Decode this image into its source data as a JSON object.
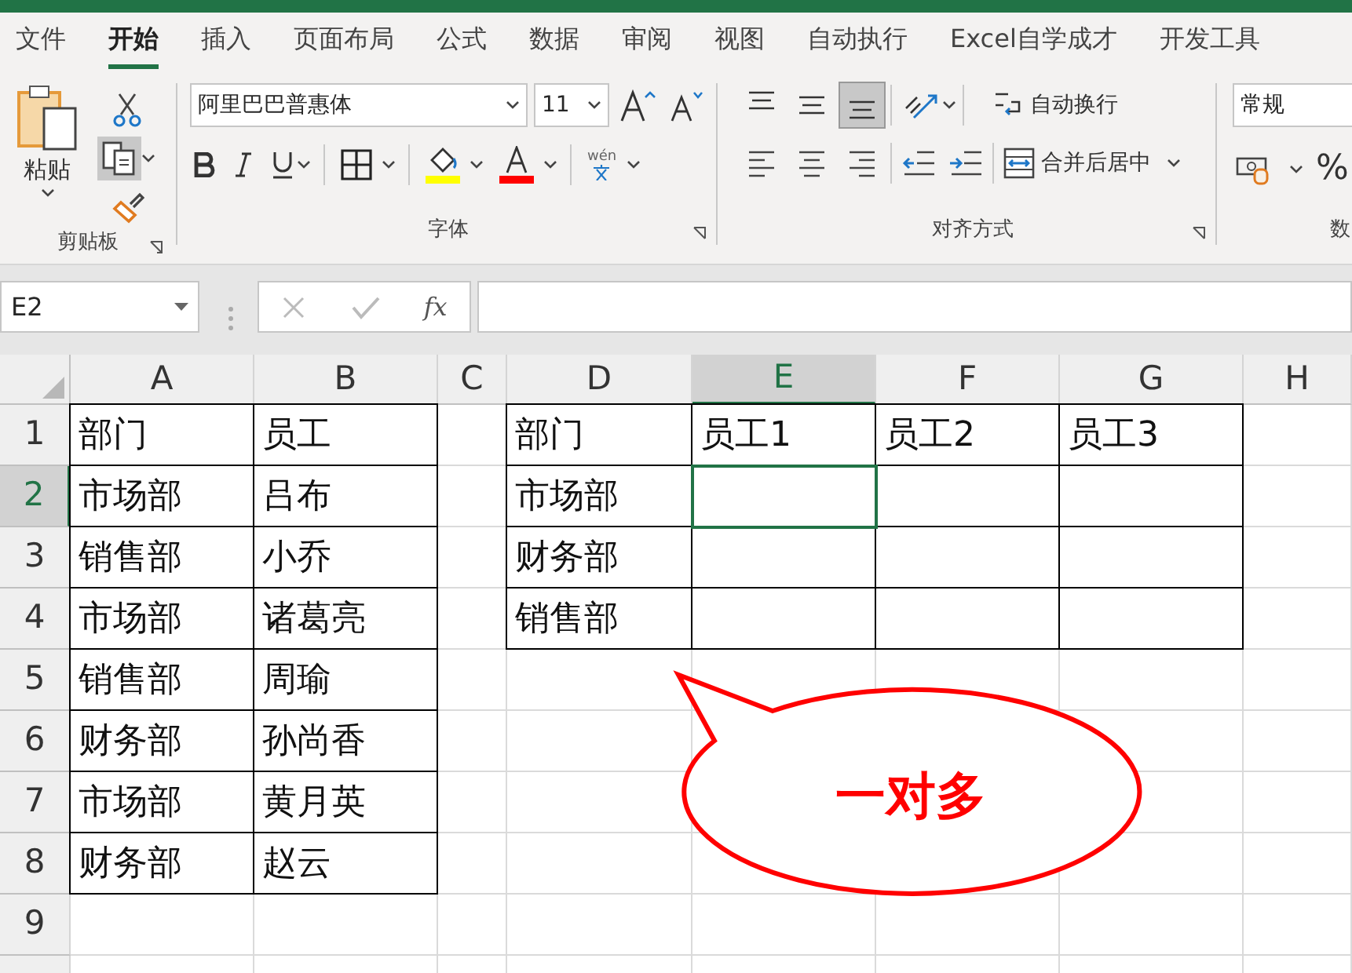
{
  "tabs": [
    {
      "label": "文件",
      "selected": false
    },
    {
      "label": "开始",
      "selected": true
    },
    {
      "label": "插入",
      "selected": false
    },
    {
      "label": "页面布局",
      "selected": false
    },
    {
      "label": "公式",
      "selected": false
    },
    {
      "label": "数据",
      "selected": false
    },
    {
      "label": "审阅",
      "selected": false
    },
    {
      "label": "视图",
      "selected": false
    },
    {
      "label": "自动执行",
      "selected": false
    },
    {
      "label": "Excel自学成才",
      "selected": false
    },
    {
      "label": "开发工具",
      "selected": false
    }
  ],
  "ribbon": {
    "clipboard": {
      "paste_label": "粘贴",
      "group_label": "剪贴板"
    },
    "font": {
      "font_name": "阿里巴巴普惠体",
      "font_size": "11",
      "phonetic_label": "wén",
      "group_label": "字体"
    },
    "alignment": {
      "vertical_buttons": [
        {
          "kind": "top",
          "selected": false
        },
        {
          "kind": "middle",
          "selected": false
        },
        {
          "kind": "bottom",
          "selected": true
        }
      ],
      "wrap_text": "自动换行",
      "merge_center": "合并后居中",
      "group_label": "对齐方式"
    },
    "number": {
      "format": "常规",
      "percent": "%",
      "group_label": "数"
    }
  },
  "formula_bar": {
    "name_box": "E2",
    "fx": "fx"
  },
  "columns": [
    {
      "label": "A",
      "selected": false
    },
    {
      "label": "B",
      "selected": false
    },
    {
      "label": "C",
      "selected": false
    },
    {
      "label": "D",
      "selected": false
    },
    {
      "label": "E",
      "selected": true
    },
    {
      "label": "F",
      "selected": false
    },
    {
      "label": "G",
      "selected": false
    },
    {
      "label": "H",
      "selected": false
    }
  ],
  "rows": [
    {
      "label": "1",
      "selected": false,
      "cells": [
        {
          "text": "部门",
          "bordered": true
        },
        {
          "text": "员工",
          "bordered": true
        },
        {},
        {
          "text": "部门",
          "bordered": true
        },
        {
          "text": "员工1",
          "bordered": true
        },
        {
          "text": "员工2",
          "bordered": true
        },
        {
          "text": "员工3",
          "bordered": true
        }
      ]
    },
    {
      "label": "2",
      "selected": true,
      "cells": [
        {
          "text": "市场部",
          "bordered": true
        },
        {
          "text": "吕布",
          "bordered": true
        },
        {},
        {
          "text": "市场部",
          "bordered": true
        },
        {
          "bordered": true,
          "selected": true
        },
        {
          "bordered": true
        },
        {
          "bordered": true
        }
      ]
    },
    {
      "label": "3",
      "selected": false,
      "cells": [
        {
          "text": "销售部",
          "bordered": true
        },
        {
          "text": "小乔",
          "bordered": true
        },
        {},
        {
          "text": "财务部",
          "bordered": true
        },
        {
          "bordered": true
        },
        {
          "bordered": true
        },
        {
          "bordered": true
        }
      ]
    },
    {
      "label": "4",
      "selected": false,
      "cells": [
        {
          "text": "市场部",
          "bordered": true
        },
        {
          "text": "诸葛亮",
          "bordered": true
        },
        {},
        {
          "text": "销售部",
          "bordered": true
        },
        {
          "bordered": true
        },
        {
          "bordered": true
        },
        {
          "bordered": true
        }
      ]
    },
    {
      "label": "5",
      "selected": false,
      "cells": [
        {
          "text": "销售部",
          "bordered": true
        },
        {
          "text": "周瑜",
          "bordered": true
        }
      ]
    },
    {
      "label": "6",
      "selected": false,
      "cells": [
        {
          "text": "财务部",
          "bordered": true
        },
        {
          "text": "孙尚香",
          "bordered": true
        }
      ]
    },
    {
      "label": "7",
      "selected": false,
      "cells": [
        {
          "text": "市场部",
          "bordered": true
        },
        {
          "text": "黄月英",
          "bordered": true
        }
      ]
    },
    {
      "label": "8",
      "selected": false,
      "cells": [
        {
          "text": "财务部",
          "bordered": true
        },
        {
          "text": "赵云",
          "bordered": true
        }
      ]
    },
    {
      "label": "9",
      "selected": false
    }
  ],
  "callout": {
    "text": "一对多"
  }
}
